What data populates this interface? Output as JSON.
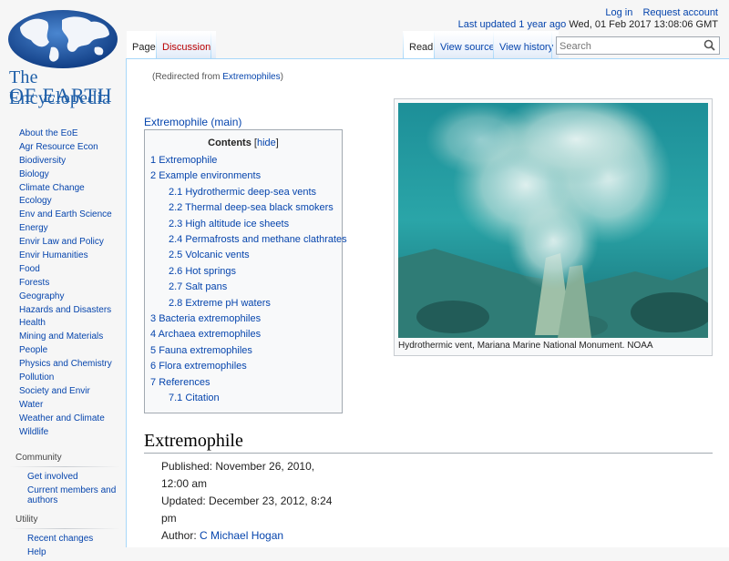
{
  "logo": {
    "line1": "The Encyclopedia",
    "line2": "OF EARTH"
  },
  "personal": {
    "login": "Log in",
    "request_account": "Request account",
    "last_updated_link": "Last updated 1 year ago",
    "last_updated_date": " Wed, 01 Feb 2017 13:08:06 GMT"
  },
  "tabs": {
    "page": "Page",
    "discussion": "Discussion",
    "read": "Read",
    "view_source": "View source",
    "view_history": "View history"
  },
  "search": {
    "placeholder": "Search"
  },
  "sidebar": {
    "nav": [
      "About the EoE",
      "Agr Resource Econ",
      "Biodiversity",
      "Biology",
      "Climate Change",
      "Ecology",
      "Env and Earth Science",
      "Energy",
      "Envir Law and Policy",
      "Envir Humanities",
      "Food",
      "Forests",
      "Geography",
      "Hazards and Disasters",
      "Health",
      "Mining and Materials",
      "People",
      "Physics and Chemistry",
      "Pollution",
      "Society and Envir",
      "Water",
      "Weather and Climate",
      "Wildlife"
    ],
    "community": {
      "heading": "Community",
      "items": [
        "Get involved",
        "Current members and authors"
      ]
    },
    "utility": {
      "heading": "Utility",
      "items": [
        "Recent changes",
        "Help"
      ]
    }
  },
  "content": {
    "redirect_prefix": "(Redirected from ",
    "redirect_link": "Extremophiles",
    "redirect_suffix": ")",
    "main_link": "Extremophile (main)",
    "toc": {
      "title": "Contents",
      "hide_open": "[",
      "hide": "hide",
      "hide_close": "]",
      "items": [
        {
          "num": "1",
          "text": "Extremophile",
          "level": 1
        },
        {
          "num": "2",
          "text": "Example environments",
          "level": 1
        },
        {
          "num": "2.1",
          "text": "Hydrothermic deep-sea vents",
          "level": 2
        },
        {
          "num": "2.2",
          "text": "Thermal deep-sea black smokers",
          "level": 2
        },
        {
          "num": "2.3",
          "text": "High altitude ice sheets",
          "level": 2
        },
        {
          "num": "2.4",
          "text": "Permafrosts and methane clathrates",
          "level": 2
        },
        {
          "num": "2.5",
          "text": "Volcanic vents",
          "level": 2
        },
        {
          "num": "2.6",
          "text": "Hot springs",
          "level": 2
        },
        {
          "num": "2.7",
          "text": "Salt pans",
          "level": 2
        },
        {
          "num": "2.8",
          "text": "Extreme pH waters",
          "level": 2
        },
        {
          "num": "3",
          "text": "Bacteria extremophiles",
          "level": 1
        },
        {
          "num": "4",
          "text": "Archaea extremophiles",
          "level": 1
        },
        {
          "num": "5",
          "text": "Fauna extremophiles",
          "level": 1
        },
        {
          "num": "6",
          "text": "Flora extremophiles",
          "level": 1
        },
        {
          "num": "7",
          "text": "References",
          "level": 1
        },
        {
          "num": "7.1",
          "text": "Citation",
          "level": 2
        }
      ]
    },
    "figure_caption": "Hydrothermic vent, Mariana Marine National Monument. NOAA",
    "heading": "Extremophile",
    "published": "Published: November 26, 2010, 12:00 am",
    "updated": "Updated: December 23, 2012, 8:24 pm",
    "author_label": "Author: ",
    "author": "C Michael Hogan"
  }
}
